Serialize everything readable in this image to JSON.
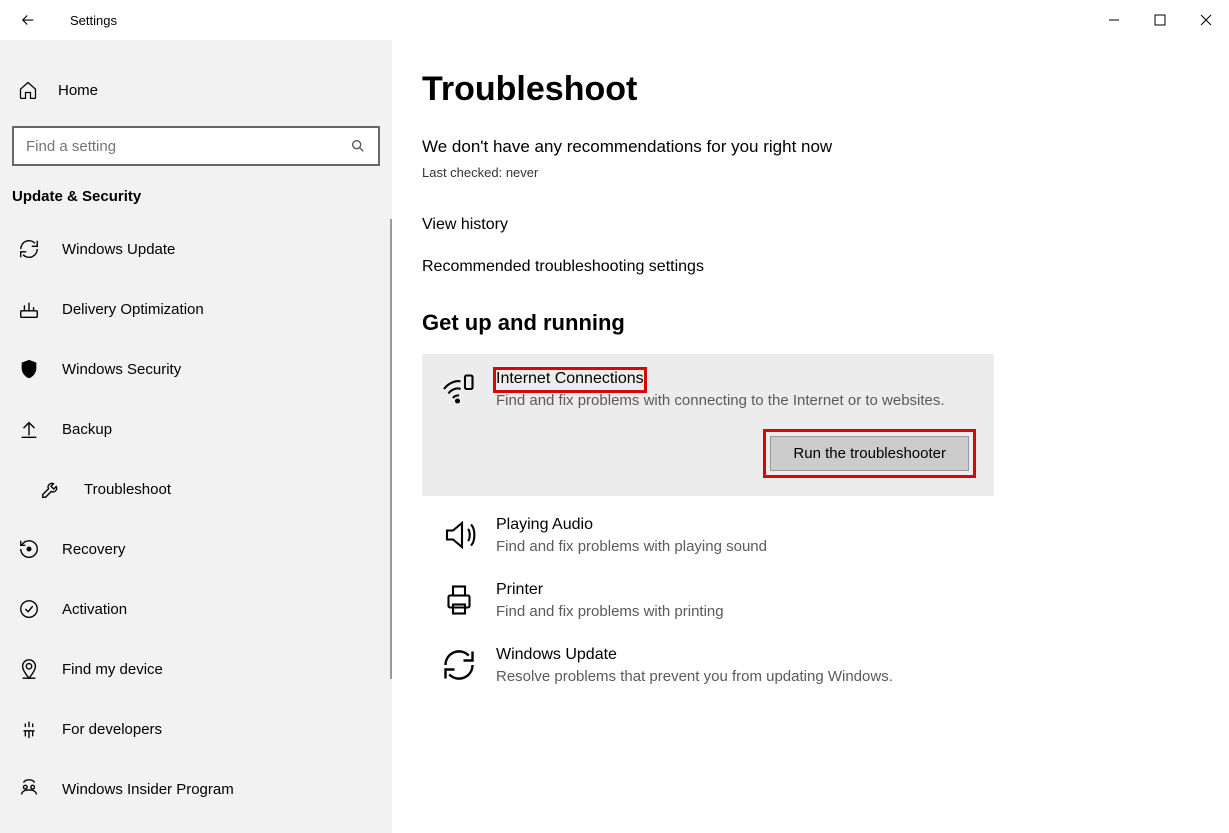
{
  "titlebar": {
    "app_title": "Settings"
  },
  "sidebar": {
    "home_label": "Home",
    "search_placeholder": "Find a setting",
    "section_title": "Update & Security",
    "items": [
      {
        "label": "Windows Update",
        "icon": "sync-icon"
      },
      {
        "label": "Delivery Optimization",
        "icon": "optimize-icon"
      },
      {
        "label": "Windows Security",
        "icon": "shield-icon"
      },
      {
        "label": "Backup",
        "icon": "backup-icon"
      },
      {
        "label": "Troubleshoot",
        "icon": "wrench-icon",
        "active": true
      },
      {
        "label": "Recovery",
        "icon": "recovery-icon"
      },
      {
        "label": "Activation",
        "icon": "check-icon"
      },
      {
        "label": "Find my device",
        "icon": "location-icon"
      },
      {
        "label": "For developers",
        "icon": "dev-icon"
      },
      {
        "label": "Windows Insider Program",
        "icon": "insider-icon"
      }
    ]
  },
  "main": {
    "page_title": "Troubleshoot",
    "recommendation_text": "We don't have any recommendations for you right now",
    "last_checked": "Last checked: never",
    "links": {
      "view_history": "View history",
      "rec_settings": "Recommended troubleshooting settings"
    },
    "section_heading": "Get up and running",
    "troubleshooters": [
      {
        "title": "Internet Connections",
        "desc": "Find and fix problems with connecting to the Internet or to websites.",
        "icon": "internet-icon",
        "expanded": true
      },
      {
        "title": "Playing Audio",
        "desc": "Find and fix problems with playing sound",
        "icon": "audio-icon"
      },
      {
        "title": "Printer",
        "desc": "Find and fix problems with printing",
        "icon": "printer-icon"
      },
      {
        "title": "Windows Update",
        "desc": "Resolve problems that prevent you from updating Windows.",
        "icon": "sync-icon"
      }
    ],
    "run_button_label": "Run the troubleshooter"
  }
}
